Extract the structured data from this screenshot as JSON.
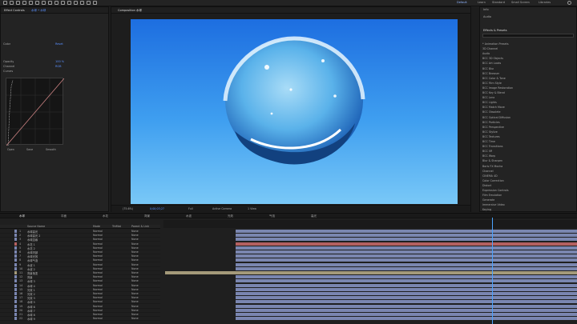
{
  "workspace_tabs": [
    "Default",
    "Learn",
    "Standard",
    "Small Screen",
    "Libraries"
  ],
  "effect_controls": {
    "title": "Effect Controls",
    "subtitle": "水球 • 水球",
    "rows": [
      {
        "label": "Color",
        "value": "Reset"
      },
      {
        "label": "Opacity",
        "value": "100 %"
      },
      {
        "label": "Channel",
        "value": "RGB"
      },
      {
        "label": "Curves",
        "value": ""
      }
    ],
    "graph_labels": [
      "Open",
      "Save",
      "Smooth"
    ]
  },
  "viewer": {
    "tab": "Composition 水球",
    "zoom": "(75.6%)",
    "timecode": "0;00;03;27",
    "resolution": "Full",
    "camera": "Active Camera",
    "views": "1 View"
  },
  "effects_panel": {
    "title": "Effects & Presets",
    "info_tab": "Info",
    "audio_tab": "Audio",
    "items": [
      "* Animation Presets",
      "3D Channel",
      "Audio",
      "BCC 3D Objects",
      "BCC Art Looks",
      "BCC Blur",
      "BCC Browser",
      "BCC Color & Tone",
      "BCC Film Style",
      "BCC Image Restoration",
      "BCC Key & Blend",
      "BCC Lens",
      "BCC Lights",
      "BCC Match Move",
      "BCC Obsolete",
      "BCC Optical Diffusion",
      "BCC Particles",
      "BCC Perspective",
      "BCC Stylize",
      "BCC Textures",
      "BCC Time",
      "BCC Transitions",
      "BCC VR",
      "BCC Warp",
      "Blur & Sharpen",
      "Boris FX Mocha",
      "Channel",
      "CINEMA 4D",
      "Color Correction",
      "Distort",
      "Expression Controls",
      "Film Emulation",
      "Generate",
      "Immersive Video",
      "Keying"
    ]
  },
  "timeline": {
    "tabs": [
      "水球",
      "平面",
      "水花",
      "背景",
      "水波",
      "光效",
      "气泡",
      "高光"
    ],
    "columns": [
      "Source Name",
      "Mode",
      "TrkMat",
      "Parent & Link"
    ],
    "mode_value": "Normal",
    "parent_value": "None",
    "layers": [
      {
        "num": "1",
        "name": "水球高光",
        "color": "#7a86b0"
      },
      {
        "num": "2",
        "name": "水球高光 2",
        "color": "#7a86b0"
      },
      {
        "num": "3",
        "name": "水球边缘",
        "color": "#7a86b0"
      },
      {
        "num": "4",
        "name": "水花 1",
        "color": "#b46060"
      },
      {
        "num": "5",
        "name": "水花 2",
        "color": "#7a86b0"
      },
      {
        "num": "6",
        "name": "水球内部",
        "color": "#7a86b0"
      },
      {
        "num": "7",
        "name": "水球光效",
        "color": "#7a86b0"
      },
      {
        "num": "8",
        "name": "水球气泡",
        "color": "#7a86b0"
      },
      {
        "num": "9",
        "name": "水波 1",
        "color": "#7a86b0"
      },
      {
        "num": "10",
        "name": "水波 2",
        "color": "#7a86b0"
      },
      {
        "num": "11",
        "name": "背景渐变",
        "color": "#a49a7a"
      },
      {
        "num": "12",
        "name": "背景",
        "color": "#7a86b0"
      },
      {
        "num": "13",
        "name": "水球 3",
        "color": "#7a86b0"
      },
      {
        "num": "14",
        "name": "水球 4",
        "color": "#7a86b0"
      },
      {
        "num": "15",
        "name": "光效 1",
        "color": "#7a86b0"
      },
      {
        "num": "16",
        "name": "光效 2",
        "color": "#7a86b0"
      },
      {
        "num": "17",
        "name": "光效 3",
        "color": "#7a86b0"
      },
      {
        "num": "18",
        "name": "水球 5",
        "color": "#7a86b0"
      },
      {
        "num": "19",
        "name": "水球 6",
        "color": "#7a86b0"
      },
      {
        "num": "20",
        "name": "水球 7",
        "color": "#7a86b0"
      },
      {
        "num": "21",
        "name": "水球 8",
        "color": "#7a86b0"
      },
      {
        "num": "22",
        "name": "水球 9",
        "color": "#7a86b0"
      }
    ]
  },
  "colors": {
    "accent": "#4aa3ff",
    "sky_top": "#1d6ee0",
    "sky_bottom": "#79c8f7",
    "track_default": "#7a86b0",
    "track_red": "#b46060",
    "track_tan": "#a49a7a"
  }
}
